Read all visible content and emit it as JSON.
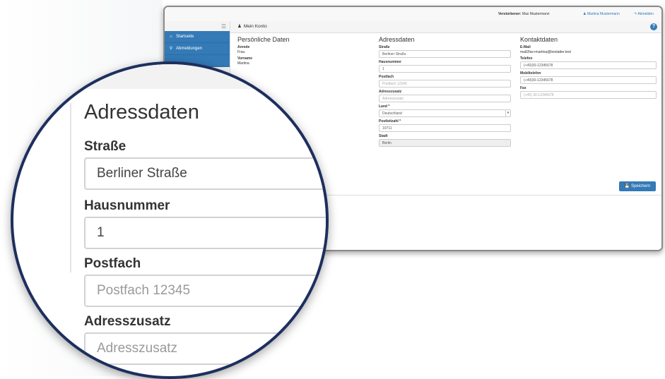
{
  "topbar": {
    "deceased_label": "Verstorbener:",
    "deceased_name": "Max Mustermann",
    "user_name": "Martina Mustermann",
    "logout_label": "Abmelden"
  },
  "sidebar": {
    "items": [
      {
        "label": "Startseite",
        "icon": "home-icon"
      },
      {
        "label": "Abmeldungen",
        "icon": "search-icon"
      }
    ]
  },
  "page": {
    "title": "Mein Konto",
    "save_label": "Speichern"
  },
  "personal": {
    "heading": "Persönliche Daten",
    "fields": [
      {
        "label": "Anrede",
        "value": "Frau"
      },
      {
        "label": "Vorname",
        "value": "Martina"
      }
    ]
  },
  "address": {
    "heading": "Adressdaten",
    "street_label": "Straße",
    "street_value": "Berliner Straße",
    "house_label": "Hausnummer",
    "house_value": "1",
    "pobox_label": "Postfach",
    "pobox_placeholder": "Postfach 12345",
    "addition_label": "Adresszusatz",
    "addition_placeholder": "Adresszusatz",
    "country_label": "Land *",
    "country_value": "Deutschland",
    "zip_label": "Postleitzahl *",
    "zip_value": "10711",
    "city_label": "Stadt",
    "city_value": "Berlin"
  },
  "contact": {
    "heading": "Kontaktdaten",
    "email_label": "E-Mail",
    "email_value": "mail2fax+martina@bestatter.test",
    "phone_label": "Telefon",
    "phone_value": "(+49)30-12345678",
    "mobile_label": "Mobiltelefon",
    "mobile_value": "(+49)30-12345678",
    "fax_label": "Fax",
    "fax_placeholder": "(+49) 30-12345678"
  }
}
